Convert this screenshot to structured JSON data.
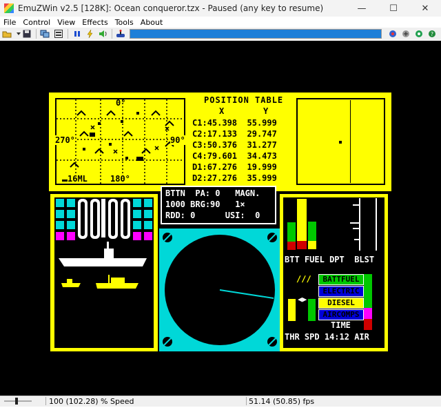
{
  "window": {
    "title": "EmuZWin v2.5 [128K]: Ocean conqueror.tzx - Paused (any key to resume)",
    "minimize_glyph": "—",
    "maximize_glyph": "☐",
    "close_glyph": "✕"
  },
  "menu": [
    "File",
    "Control",
    "View",
    "Effects",
    "Tools",
    "About"
  ],
  "game": {
    "map": {
      "bearing_top": "0°",
      "bearing_left": "270°",
      "bearing_right": "90°",
      "bearing_bottom": "180°",
      "scale": "16ML"
    },
    "position_table": {
      "title": "POSITION TABLE",
      "col_x": "X",
      "col_y": "Y",
      "rows": [
        {
          "id": "C1",
          "x": "45.398",
          "y": "55.999"
        },
        {
          "id": "C2",
          "x": "17.133",
          "y": "29.747"
        },
        {
          "id": "C3",
          "x": "50.376",
          "y": "31.277"
        },
        {
          "id": "C4",
          "x": "79.601",
          "y": "34.473"
        },
        {
          "id": "D1",
          "x": "67.276",
          "y": "19.999"
        },
        {
          "id": "D2",
          "x": "27.276",
          "y": "35.999"
        }
      ]
    },
    "status": {
      "bttn": "BTTN",
      "pa_label": "PA:",
      "pa_value": "0",
      "magn_label": "MAGN.",
      "depth": "1000",
      "brg_label": "BRG:",
      "brg_value": "90",
      "magn_value": "1×",
      "rdd_label": "RDD:",
      "rdd_value": "0",
      "usi_label": "USI:",
      "usi_value": "0"
    },
    "gauges": {
      "labels": [
        "BTT",
        "FUEL",
        "DPT",
        "BLST"
      ],
      "btt_level": 0.55,
      "fuel_level": 0.55
    },
    "engine": {
      "modes": [
        "BATTFUEL",
        "ELECTRIC",
        "DIESEL",
        "AIRCOMPS"
      ],
      "time_label": "TIME",
      "time": "14:12",
      "thr": "THR",
      "spd": "SPD",
      "air": "AIR",
      "arrows": "◀▶",
      "throttle_marks": "∕∕∕"
    }
  },
  "status_bar": {
    "speed": "100 (102.28) % Speed",
    "fps": "51.14 (50.85) fps"
  },
  "colors": {
    "zx_yellow": "#ffff00",
    "zx_cyan": "#00d8d8",
    "zx_magenta": "#ff00ff",
    "zx_green": "#00c800",
    "zx_red": "#d00000",
    "zx_blue": "#0000d8",
    "emu_progress": "#1e7fd8"
  }
}
